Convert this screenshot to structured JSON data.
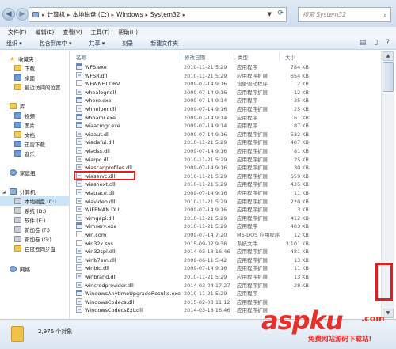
{
  "address": {
    "crumbs": [
      "计算机",
      "本地磁盘 (C:)",
      "Windows",
      "System32"
    ],
    "search_placeholder": "搜索 System32"
  },
  "menu": [
    "文件(F)",
    "编辑(E)",
    "查看(V)",
    "工具(T)",
    "帮助(H)"
  ],
  "toolbar": [
    "组织 ▾",
    "包含到库中 ▾",
    "共享 ▾",
    "刻录",
    "新建文件夹"
  ],
  "nav": [
    {
      "label": "收藏夹",
      "icon": "star-icon"
    },
    {
      "label": "下载",
      "icon": "folder-icon"
    },
    {
      "label": "桌面",
      "icon": "folder-icon"
    },
    {
      "label": "最近访问的位置",
      "icon": "folder-icon"
    },
    {
      "label": "库",
      "icon": "library-icon"
    },
    {
      "label": "视频",
      "icon": "folder-icon"
    },
    {
      "label": "图片",
      "icon": "folder-icon"
    },
    {
      "label": "文档",
      "icon": "folder-icon"
    },
    {
      "label": "迅雷下载",
      "icon": "folder-icon"
    },
    {
      "label": "音乐",
      "icon": "folder-icon"
    },
    {
      "label": "家庭组",
      "icon": "homegroup-icon"
    },
    {
      "label": "计算机",
      "icon": "computer-icon"
    },
    {
      "label": "本地磁盘 (C:)",
      "icon": "drive-icon"
    },
    {
      "label": "系统 (D:)",
      "icon": "drive-icon"
    },
    {
      "label": "软件 (E:)",
      "icon": "drive-icon"
    },
    {
      "label": "新加卷 (F:)",
      "icon": "drive-icon"
    },
    {
      "label": "新加卷 (G:)",
      "icon": "drive-icon"
    },
    {
      "label": "百度云同步盘",
      "icon": "folder-icon"
    },
    {
      "label": "网络",
      "icon": "network-icon"
    }
  ],
  "columns": {
    "name": "名称",
    "date": "修改日期",
    "type": "类型",
    "size": "大小"
  },
  "files": [
    {
      "name": "WFS.exe",
      "date": "2010-11-21 5:29",
      "type": "应用程序",
      "size": "784 KB",
      "kind": "exe"
    },
    {
      "name": "WFSR.dll",
      "date": "2010-11-21 5:29",
      "type": "应用程序扩展",
      "size": "654 KB",
      "kind": "dll"
    },
    {
      "name": "WFWNET.DRV",
      "date": "2009-07-14 9:16",
      "type": "设备驱动程序",
      "size": "2 KB",
      "kind": "gen"
    },
    {
      "name": "whealogr.dll",
      "date": "2009-07-14 9:16",
      "type": "应用程序扩展",
      "size": "12 KB",
      "kind": "dll"
    },
    {
      "name": "where.exe",
      "date": "2009-07-14 9:14",
      "type": "应用程序",
      "size": "35 KB",
      "kind": "exe"
    },
    {
      "name": "whhelper.dll",
      "date": "2009-07-14 9:16",
      "type": "应用程序扩展",
      "size": "25 KB",
      "kind": "dll"
    },
    {
      "name": "whoami.exe",
      "date": "2009-07-14 9:14",
      "type": "应用程序",
      "size": "61 KB",
      "kind": "exe"
    },
    {
      "name": "wiaacmgr.exe",
      "date": "2009-07-14 9:14",
      "type": "应用程序",
      "size": "87 KB",
      "kind": "exe"
    },
    {
      "name": "wiaaut.dll",
      "date": "2009-07-14 9:16",
      "type": "应用程序扩展",
      "size": "532 KB",
      "kind": "dll"
    },
    {
      "name": "wiadefui.dll",
      "date": "2010-11-21 5:29",
      "type": "应用程序扩展",
      "size": "407 KB",
      "kind": "dll"
    },
    {
      "name": "wiadss.dll",
      "date": "2009-07-14 9:16",
      "type": "应用程序扩展",
      "size": "81 KB",
      "kind": "dll"
    },
    {
      "name": "wiarpc.dll",
      "date": "2010-11-21 5:29",
      "type": "应用程序扩展",
      "size": "25 KB",
      "kind": "dll"
    },
    {
      "name": "wiascanprofiles.dll",
      "date": "2009-07-14 9:16",
      "type": "应用程序扩展",
      "size": "30 KB",
      "kind": "dll"
    },
    {
      "name": "wiaservc.dll",
      "date": "2010-11-21 5:29",
      "type": "应用程序扩展",
      "size": "659 KB",
      "kind": "dll"
    },
    {
      "name": "wiashext.dll",
      "date": "2010-11-21 5:29",
      "type": "应用程序扩展",
      "size": "435 KB",
      "kind": "dll"
    },
    {
      "name": "wiatrace.dll",
      "date": "2009-07-14 9:16",
      "type": "应用程序扩展",
      "size": "11 KB",
      "kind": "dll"
    },
    {
      "name": "wiavideo.dll",
      "date": "2010-11-21 5:29",
      "type": "应用程序扩展",
      "size": "220 KB",
      "kind": "dll"
    },
    {
      "name": "WIFEMAN.DLL",
      "date": "2009-07-14 9:16",
      "type": "应用程序扩展",
      "size": "3 KB",
      "kind": "dll"
    },
    {
      "name": "wimgapi.dll",
      "date": "2010-11-21 5:29",
      "type": "应用程序扩展",
      "size": "412 KB",
      "kind": "dll"
    },
    {
      "name": "wimserv.exe",
      "date": "2010-11-21 5:29",
      "type": "应用程序",
      "size": "403 KB",
      "kind": "exe"
    },
    {
      "name": "win.com",
      "date": "2009-07-14 7:20",
      "type": "MS-DOS 应用程序",
      "size": "12 KB",
      "kind": "gen"
    },
    {
      "name": "win32k.sys",
      "date": "2015-09-02 9:36",
      "type": "系统文件",
      "size": "3,101 KB",
      "kind": "gen"
    },
    {
      "name": "win32spl.dll",
      "date": "2014-03-18 16:46",
      "type": "应用程序扩展",
      "size": "481 KB",
      "kind": "dll"
    },
    {
      "name": "winb7em.dll",
      "date": "2009-06-11 5:42",
      "type": "应用程序扩展",
      "size": "13 KB",
      "kind": "dll"
    },
    {
      "name": "winbio.dll",
      "date": "2009-07-14 9:16",
      "type": "应用程序扩展",
      "size": "11 KB",
      "kind": "dll"
    },
    {
      "name": "winbrand.dll",
      "date": "2010-11-21 5:29",
      "type": "应用程序扩展",
      "size": "13 KB",
      "kind": "dll"
    },
    {
      "name": "wincredprovider.dll",
      "date": "2014-03-04 17:27",
      "type": "应用程序扩展",
      "size": "28 KB",
      "kind": "dll"
    },
    {
      "name": "WindowsAnytimeUpgradeResults.exe",
      "date": "2010-11-21 5:29",
      "type": "应用程序",
      "size": "",
      "kind": "exe"
    },
    {
      "name": "WindowsCodecs.dll",
      "date": "2015-02-03 11:12",
      "type": "应用程序扩展",
      "size": "",
      "kind": "dll"
    },
    {
      "name": "WindowsCodecsExt.dll",
      "date": "2014-03-18 16:46",
      "type": "应用程序扩展",
      "size": "",
      "kind": "dll"
    }
  ],
  "status": {
    "count": "2,976 个对象"
  },
  "watermark": {
    "main": "aspku",
    "tld": ".com",
    "sub": "免费网站源码下载站!"
  },
  "colors": {
    "accent": "#e02020",
    "selection": "#cce4f7"
  }
}
